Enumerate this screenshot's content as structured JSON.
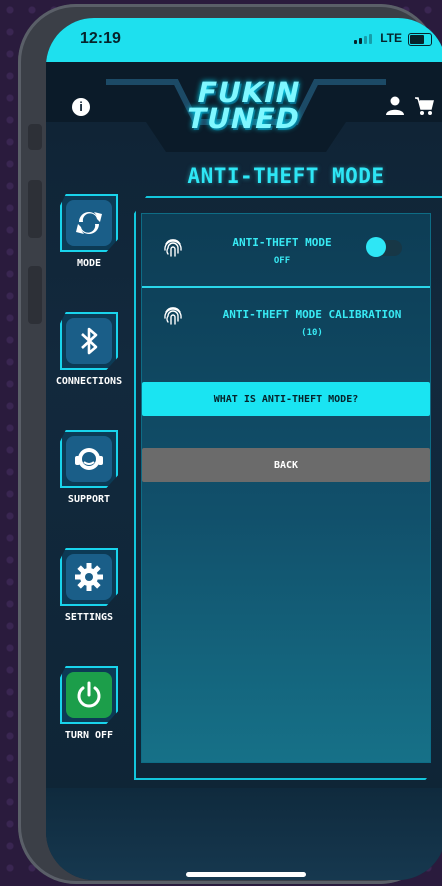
{
  "status_bar": {
    "time": "12:19",
    "network": "LTE"
  },
  "header": {
    "logo_line1": "FUKIN",
    "logo_line2": "TUNED",
    "info_glyph": "i"
  },
  "page_title": "ANTI-THEFT MODE",
  "nav": [
    {
      "label": "MODE",
      "icon": "sync-icon"
    },
    {
      "label": "CONNECTIONS",
      "icon": "bluetooth-icon"
    },
    {
      "label": "SUPPORT",
      "icon": "headset-icon"
    },
    {
      "label": "SETTINGS",
      "icon": "gear-icon"
    },
    {
      "label": "TURN OFF",
      "icon": "power-icon"
    }
  ],
  "rows": [
    {
      "title": "ANTI-THEFT MODE",
      "sub": "OFF",
      "icon": "fingerprint-icon"
    },
    {
      "title": "ANTI-THEFT MODE CALIBRATION",
      "sub": "(10)",
      "icon": "fingerprint-icon"
    }
  ],
  "toggle": {
    "state": "off"
  },
  "buttons": {
    "what": "WHAT IS ANTI-THEFT MODE?",
    "back": "BACK"
  },
  "colors": {
    "accent": "#1ae4f2",
    "panel": "#0d3d55",
    "back_button": "#6b6b6b",
    "turn_off": "#1c9e4a"
  }
}
